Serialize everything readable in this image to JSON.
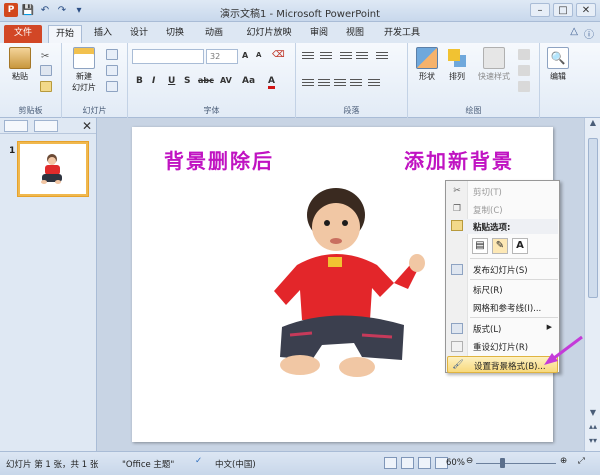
{
  "window": {
    "title": "演示文稿1 - Microsoft PowerPoint",
    "qat_icons": [
      "powerpoint-logo-icon",
      "save-icon",
      "undo-icon",
      "redo-icon",
      "customize-qat-icon"
    ]
  },
  "tabs": [
    "文件",
    "开始",
    "插入",
    "设计",
    "切换",
    "动画",
    "幻灯片放映",
    "审阅",
    "视图",
    "开发工具"
  ],
  "active_tab": "开始",
  "ribbon": {
    "groups": {
      "clipboard": {
        "label": "剪贴板",
        "paste_label": "粘贴"
      },
      "slides": {
        "label": "幻灯片",
        "new_slide_label_1": "新建",
        "new_slide_label_2": "幻灯片"
      },
      "font": {
        "label": "字体",
        "font_size": "32"
      },
      "paragraph": {
        "label": "段落"
      },
      "drawing": {
        "label": "绘图",
        "shape_label": "形状",
        "arrange_label": "排列",
        "quick_styles_label": "快速样式"
      },
      "editing": {
        "label": "编辑"
      }
    },
    "format_buttons": [
      "B",
      "I",
      "U",
      "S",
      "abc",
      "AV",
      "Aa",
      "A"
    ]
  },
  "slide_pane": {
    "slide_number": "1"
  },
  "slide": {
    "text_left": "背景删除后",
    "text_right": "添加新背景"
  },
  "context_menu": {
    "items": [
      {
        "label": "剪切(T)",
        "icon": "scissors-icon",
        "enabled": false
      },
      {
        "label": "复制(C)",
        "icon": "copy-icon",
        "enabled": false
      },
      {
        "label": "发布幻灯片(S)",
        "icon": "publish-slides-icon",
        "enabled": true
      },
      {
        "label": "标尺(R)",
        "icon": "",
        "enabled": true
      },
      {
        "label": "网格和参考线(I)...",
        "icon": "",
        "enabled": true
      },
      {
        "label": "版式(L)",
        "icon": "layout-icon",
        "enabled": true
      },
      {
        "label": "重设幻灯片(R)",
        "icon": "reset-slide-icon",
        "enabled": true
      },
      {
        "label": "设置背景格式(B)...",
        "icon": "format-background-icon",
        "enabled": true
      }
    ],
    "paste_options_label": "粘贴选项:",
    "paste_buttons": [
      "paste-use-destination-theme-icon",
      "paste-keep-source-formatting-icon",
      "A"
    ]
  },
  "status_bar": {
    "slide_info": "幻灯片 第 1 张，共 1 张",
    "theme": "\"Office 主题\"",
    "language": "中文(中国)",
    "zoom": "60%"
  },
  "colors": {
    "slide_text": "#c013c2",
    "file_tab": "#d24726",
    "highlight": "#f8d97c",
    "arrow": "#c43bd9"
  }
}
